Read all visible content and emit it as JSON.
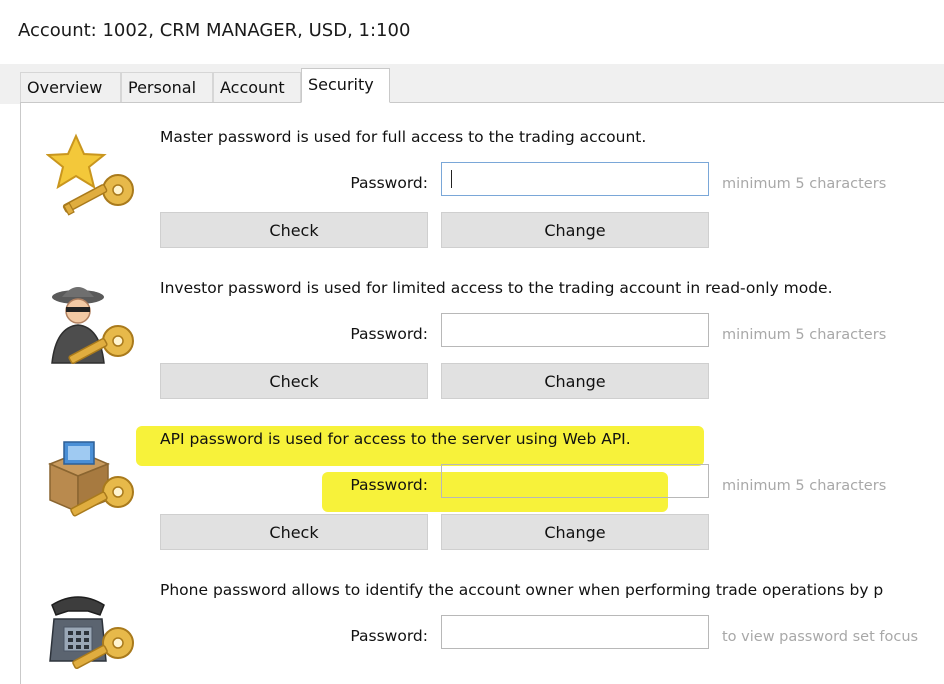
{
  "window": {
    "title": "Account: 1002, CRM MANAGER, USD, 1:100"
  },
  "tabs": [
    {
      "label": "Overview",
      "active": false
    },
    {
      "label": "Personal",
      "active": false
    },
    {
      "label": "Account",
      "active": false
    },
    {
      "label": "Security",
      "active": true
    }
  ],
  "sections": [
    {
      "icon": "star-key-icon",
      "description": "Master password is used for full access to the trading account.",
      "password_label": "Password:",
      "password_value": "",
      "hint": "minimum 5 characters",
      "check_label": "Check",
      "change_label": "Change"
    },
    {
      "icon": "spy-key-icon",
      "description": "Investor password is used for limited access to the trading account in read-only mode.",
      "password_label": "Password:",
      "password_value": "",
      "hint": "minimum 5 characters",
      "check_label": "Check",
      "change_label": "Change"
    },
    {
      "icon": "box-key-icon",
      "description": "API password is used for access to the server using Web API.",
      "password_label": "Password:",
      "password_value": "",
      "hint": "minimum 5 characters",
      "check_label": "Check",
      "change_label": "Change",
      "highlight_color": "#f7f23a"
    },
    {
      "icon": "phone-key-icon",
      "description": "Phone password allows to identify the account owner when performing trade operations by p",
      "password_label": "Password:",
      "password_value": "",
      "hint": "to view password set focus"
    }
  ]
}
